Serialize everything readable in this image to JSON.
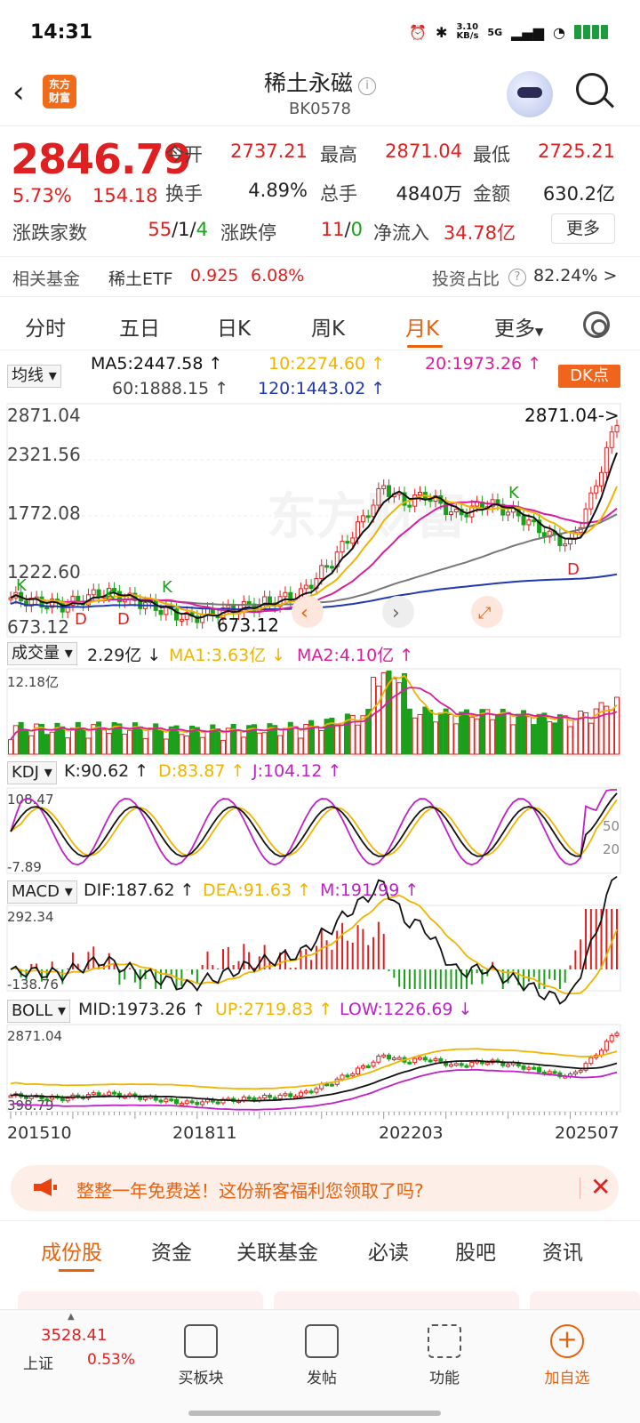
{
  "status_bar": {
    "time": "14:31",
    "net_speed": "3.10\nKB/s",
    "network": "5G"
  },
  "header": {
    "logo_text": "东方\n财富",
    "title": "稀土永磁",
    "code": "BK0578",
    "info_glyph": "i"
  },
  "quote": {
    "price": "2846.79",
    "change_pct": "5.73%",
    "change": "154.18",
    "fields": [
      {
        "label": "今开",
        "value": "2737.21"
      },
      {
        "label": "最高",
        "value": "2871.04"
      },
      {
        "label": "最低",
        "value": "2725.21"
      },
      {
        "label": "换手",
        "value": "4.89%"
      },
      {
        "label": "总手",
        "value": "4840万"
      },
      {
        "label": "金额",
        "value": "630.2亿"
      }
    ],
    "breadth_label": "涨跌家数",
    "breadth_up": "55",
    "breadth_flat": "1",
    "breadth_down": "4",
    "limit_label": "涨跌停",
    "limit_up": "11",
    "limit_down": "0",
    "inflow_label": "净流入",
    "inflow_value": "34.78亿",
    "more_button": "更多",
    "fund_label": "相关基金",
    "fund_name": "稀土ETF",
    "fund_price": "0.925",
    "fund_pct": "6.08%",
    "invest_label": "投资占比",
    "invest_value": "82.24% >"
  },
  "period_tabs": [
    "分时",
    "五日",
    "日K",
    "周K",
    "月K",
    "更多"
  ],
  "active_period": "月K",
  "ma": {
    "selector": "均线",
    "ma5": "MA5:2447.58 ↑",
    "ma10": "10:2274.60 ↑",
    "ma20": "20:1973.26 ↑",
    "ma60": "60:1888.15 ↑",
    "ma120": "120:1443.02 ↑",
    "dk_button": "DK点",
    "colors": {
      "ma5": "#111111",
      "ma10": "#f0b400",
      "ma20": "#d81e9c",
      "ma60": "#777777",
      "ma120": "#2038b0"
    }
  },
  "kline": {
    "yticks": [
      "2871.04",
      "2321.56",
      "1772.08",
      "1222.60",
      "673.12"
    ],
    "max_marker": "2871.04->",
    "min_marker": "673.12",
    "watermark": "东方财富"
  },
  "volume": {
    "selector": "成交量",
    "value": "2.29亿 ↓",
    "ma1": "MA1:3.63亿 ↓",
    "ma2": "MA2:4.10亿 ↑",
    "ymax": "12.18亿"
  },
  "kdj": {
    "selector": "KDJ",
    "k": "K:90.62 ↑",
    "d": "D:83.87 ↑",
    "j": "J:104.12 ↑",
    "ymax": "108.47",
    "ymin": "-7.89",
    "l50": "50",
    "l20": "20"
  },
  "macd": {
    "selector": "MACD",
    "dif": "DIF:187.62 ↑",
    "dea": "DEA:91.63 ↑",
    "m": "M:191.99 ↑",
    "ymax": "292.34",
    "ymin": "-138.76"
  },
  "boll": {
    "selector": "BOLL",
    "mid": "MID:1973.26 ↑",
    "up": "UP:2719.83 ↑",
    "low": "LOW:1226.69 ↓",
    "ymax": "2871.04",
    "ymin": "398.79"
  },
  "x_axis": [
    "201510",
    "201811",
    "202203",
    "202507"
  ],
  "chart_data": {
    "type": "candlestick",
    "x": [
      "201510",
      "201811",
      "202203",
      "202507"
    ],
    "ylim": [
      673.12,
      2871.04
    ],
    "values": {
      "last": 2846.79,
      "high": 2871.04,
      "low_marker": 673.12
    }
  },
  "promo": {
    "text": "整整一年免费送！这份新客福利您领取了吗?"
  },
  "content_tabs": [
    "成份股",
    "资金",
    "关联基金",
    "必读",
    "股吧",
    "资讯"
  ],
  "bottom_nav": {
    "index_name": "上证",
    "index_value": "3528.41",
    "index_pct": "0.53%",
    "items": [
      "买板块",
      "发帖",
      "功能",
      "加自选"
    ]
  }
}
